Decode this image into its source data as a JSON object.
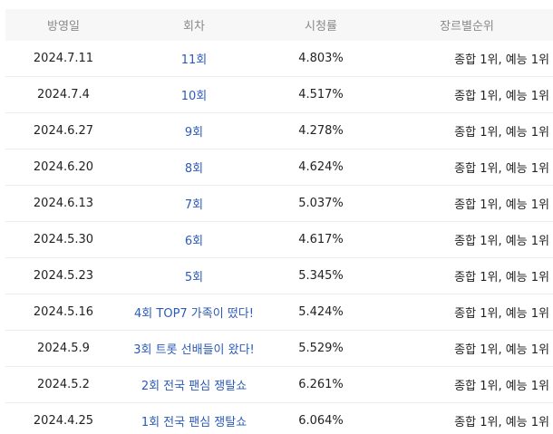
{
  "table": {
    "headers": [
      "방영일",
      "회차",
      "시청률",
      "장르별순위"
    ],
    "rows": [
      {
        "date": "2024.7.11",
        "episode": "11회",
        "rating": "4.803%",
        "rank": "종합 1위, 예능 1위"
      },
      {
        "date": "2024.7.4",
        "episode": "10회",
        "rating": "4.517%",
        "rank": "종합 1위, 예능 1위"
      },
      {
        "date": "2024.6.27",
        "episode": "9회",
        "rating": "4.278%",
        "rank": "종합 1위, 예능 1위"
      },
      {
        "date": "2024.6.20",
        "episode": "8회",
        "rating": "4.624%",
        "rank": "종합 1위, 예능 1위"
      },
      {
        "date": "2024.6.13",
        "episode": "7회",
        "rating": "5.037%",
        "rank": "종합 1위, 예능 1위"
      },
      {
        "date": "2024.5.30",
        "episode": "6회",
        "rating": "4.617%",
        "rank": "종합 1위, 예능 1위"
      },
      {
        "date": "2024.5.23",
        "episode": "5회",
        "rating": "5.345%",
        "rank": "종합 1위, 예능 1위"
      },
      {
        "date": "2024.5.16",
        "episode": "4회 TOP7 가족이 떴다!",
        "rating": "5.424%",
        "rank": "종합 1위, 예능 1위"
      },
      {
        "date": "2024.5.9",
        "episode": "3회 트롯 선배들이 왔다!",
        "rating": "5.529%",
        "rank": "종합 1위, 예능 1위"
      },
      {
        "date": "2024.5.2",
        "episode": "2회 전국 팬심 쟁탈쇼",
        "rating": "6.261%",
        "rank": "종합 1위, 예능 1위"
      },
      {
        "date": "2024.4.25",
        "episode": "1회 전국 팬심 쟁탈쇼",
        "rating": "6.064%",
        "rank": "종합 1위, 예능 1위"
      }
    ]
  },
  "colors": {
    "link": "#2c5bb8",
    "header_bg": "#f7f7f8",
    "header_text": "#8a8a8a"
  }
}
